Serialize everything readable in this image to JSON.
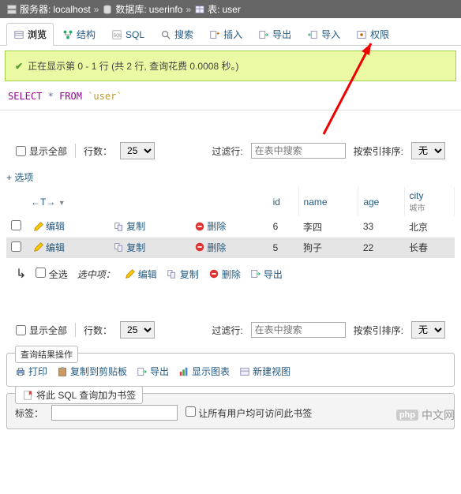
{
  "breadcrumb": {
    "server_label": "服务器:",
    "server": "localhost",
    "db_label": "数据库:",
    "db": "userinfo",
    "table_label": "表:",
    "table": "user"
  },
  "tabs": {
    "browse": "浏览",
    "structure": "结构",
    "sql": "SQL",
    "search": "搜索",
    "insert": "插入",
    "export": "导出",
    "import": "导入",
    "privileges": "权限"
  },
  "status": "正在显示第 0 - 1 行 (共 2 行, 查询花费 0.0008 秒。)",
  "sql": {
    "select": "SELECT",
    "star": "*",
    "from": "FROM",
    "table": "`user`"
  },
  "controls": {
    "show_all": "显示全部",
    "rows_label": "行数：",
    "rows_value": "25",
    "filter_label": "过滤行:",
    "filter_placeholder": "在表中搜索",
    "sort_label": "按索引排序:",
    "sort_value": "无"
  },
  "options_link": "+ 选项",
  "table": {
    "headers": {
      "t": "←T→",
      "id": "id",
      "name": "name",
      "age": "age",
      "city": "city",
      "city_cn": "城市"
    },
    "actions": {
      "edit": "编辑",
      "copy": "复制",
      "delete": "删除"
    },
    "rows": [
      {
        "id": "6",
        "name": "李四",
        "age": "33",
        "city": "北京"
      },
      {
        "id": "5",
        "name": "狗子",
        "age": "22",
        "city": "长春"
      }
    ]
  },
  "bulk": {
    "select_all": "全选",
    "with_selected": "选中项：",
    "edit": "编辑",
    "copy": "复制",
    "delete": "删除",
    "export": "导出"
  },
  "ops": {
    "title": "查询结果操作",
    "print": "打印",
    "clipboard": "复制到剪贴板",
    "export": "导出",
    "chart": "显示图表",
    "view": "新建视图"
  },
  "bookmark": {
    "title": "将此 SQL 查询加为书签",
    "label": "标签：",
    "allow_all": "让所有用户均可访问此书签"
  },
  "watermark": "中文网"
}
